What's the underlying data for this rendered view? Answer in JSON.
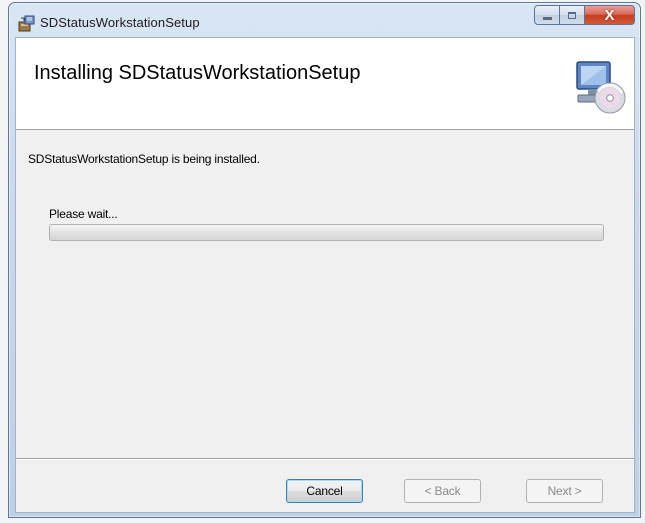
{
  "window": {
    "title": "SDStatusWorkstationSetup",
    "app_icon": "installer-package-icon",
    "controls": {
      "minimize_icon": "minimize-icon",
      "maximize_icon": "maximize-icon",
      "close_label": "X"
    }
  },
  "banner": {
    "heading": "Installing SDStatusWorkstationSetup",
    "art_icon": "computer-disc-icon"
  },
  "main": {
    "status_text": "SDStatusWorkstationSetup is being installed.",
    "progress_label": "Please wait...",
    "progress_value": 0
  },
  "buttons": {
    "cancel": "Cancel",
    "back": "< Back",
    "next": "Next >"
  },
  "colors": {
    "progress_fill": "#30c030",
    "default_button_border": "#3c7fb1",
    "close_button": "#c53d22"
  }
}
